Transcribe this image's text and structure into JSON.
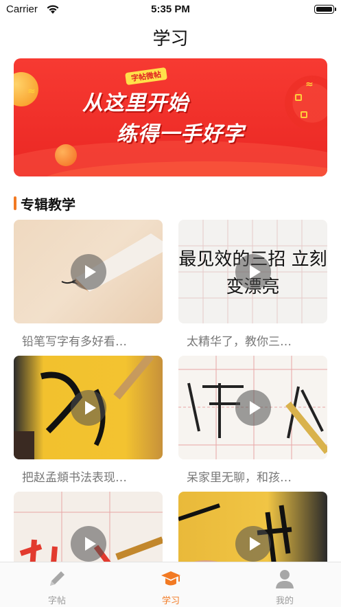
{
  "status_bar": {
    "carrier": "Carrier",
    "time": "5:35 PM"
  },
  "nav": {
    "title": "学习"
  },
  "banner": {
    "tag": "字帖微帖",
    "line1": "从这里开始",
    "line2": "练得一手好字"
  },
  "section": {
    "title": "专辑教学"
  },
  "videos": [
    {
      "title": "铅笔写字有多好看…",
      "thumb_text": ""
    },
    {
      "title": "太精华了，教你三…",
      "thumb_text": "最见效的三招 立刻变漂亮"
    },
    {
      "title": "把赵孟頫书法表现…",
      "thumb_text": ""
    },
    {
      "title": "呆家里无聊，和孩…",
      "thumb_text": ""
    },
    {
      "title": "",
      "thumb_text": ""
    },
    {
      "title": "",
      "thumb_text": ""
    }
  ],
  "tabbar": {
    "items": [
      {
        "label": "字帖",
        "icon": "pencil-icon",
        "active": false
      },
      {
        "label": "学习",
        "icon": "graduation-cap-icon",
        "active": true
      },
      {
        "label": "我的",
        "icon": "user-icon",
        "active": false
      }
    ]
  },
  "colors": {
    "accent": "#f27a23",
    "banner_red": "#ea2723",
    "inactive": "#9a9a9a"
  }
}
